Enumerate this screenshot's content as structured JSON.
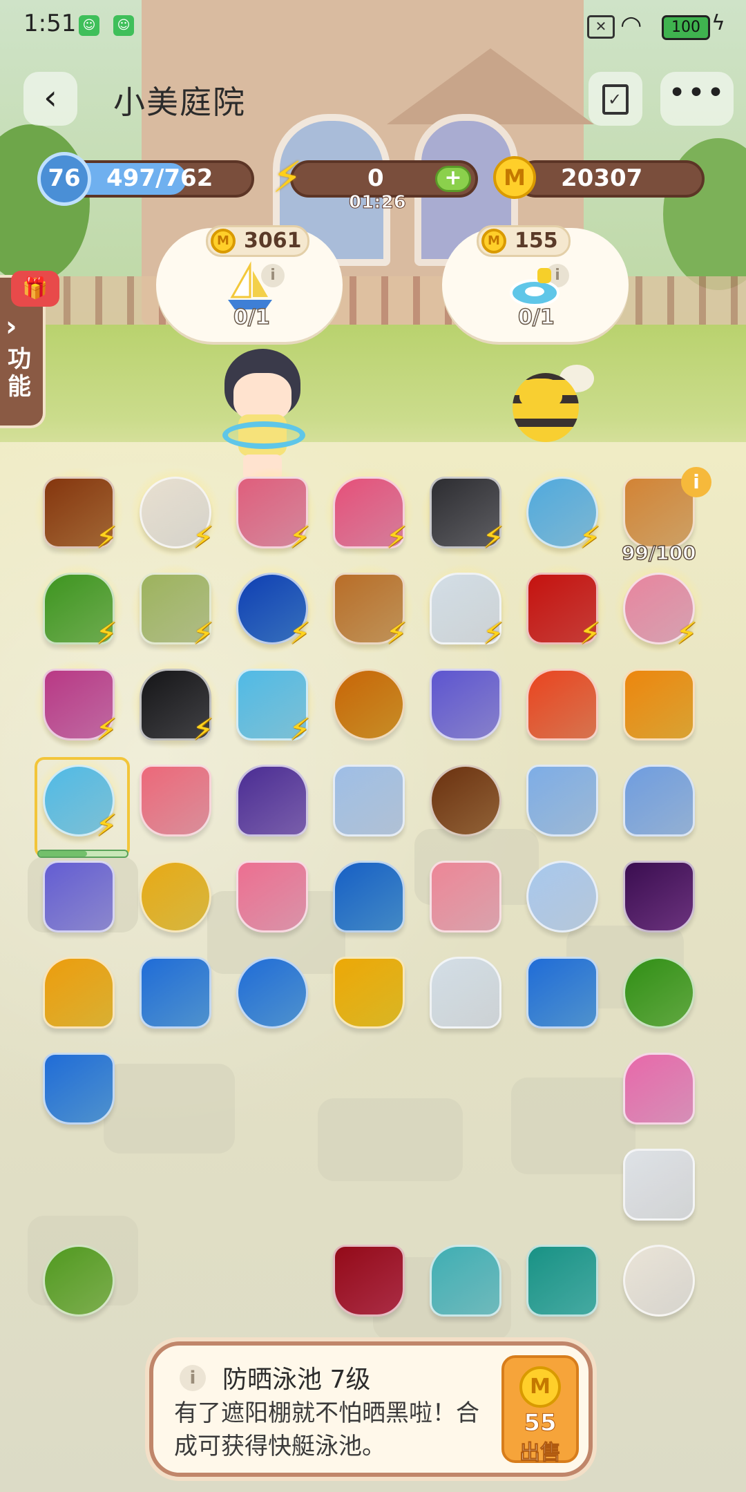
{
  "status_bar": {
    "time": "1:51",
    "battery": "100"
  },
  "header": {
    "title": "小美庭院"
  },
  "resources": {
    "level": "76",
    "xp": "497/762",
    "xp_progress": 0.65,
    "energy": "0",
    "energy_timer": "01:26",
    "coins": "20307"
  },
  "side_tab": {
    "label": "功能"
  },
  "orders": [
    {
      "reward": "3061",
      "progress": "0/1",
      "item_icon": "sailboat-icon"
    },
    {
      "reward": "155",
      "progress": "0/1",
      "item_icon": "swim-ring-icon"
    }
  ],
  "board": {
    "capacity": "99/100",
    "selected_item_progress": 0.55,
    "items": [
      {
        "name": "fruit-stand",
        "row": 0,
        "col": 0,
        "energy": true,
        "color": "#b8753c"
      },
      {
        "name": "chicken-basket",
        "row": 0,
        "col": 1,
        "energy": true,
        "color": "#f3efe6"
      },
      {
        "name": "shopping-cart",
        "row": 0,
        "col": 2,
        "energy": true,
        "color": "#ef9bb2"
      },
      {
        "name": "pink-handbag",
        "row": 0,
        "col": 3,
        "energy": true,
        "color": "#f28fb0"
      },
      {
        "name": "safe-box",
        "row": 0,
        "col": 4,
        "energy": true,
        "color": "#6b6b70"
      },
      {
        "name": "vending-fridge",
        "row": 0,
        "col": 5,
        "energy": true,
        "color": "#8fd0ee"
      },
      {
        "name": "storage-crate",
        "row": 0,
        "col": 6,
        "energy": false,
        "color": "#e8b774"
      },
      {
        "name": "flower-planter",
        "row": 1,
        "col": 0,
        "energy": true,
        "color": "#7dc35a"
      },
      {
        "name": "wicker-chair",
        "row": 1,
        "col": 1,
        "energy": true,
        "color": "#c8d69a"
      },
      {
        "name": "blue-locker",
        "row": 1,
        "col": 2,
        "energy": true,
        "color": "#3e7fd6"
      },
      {
        "name": "wooden-cabinet",
        "row": 1,
        "col": 3,
        "energy": true,
        "color": "#d9a765"
      },
      {
        "name": "greenhouse",
        "row": 1,
        "col": 4,
        "energy": true,
        "color": "#e8eef2"
      },
      {
        "name": "red-treasure-chest",
        "row": 1,
        "col": 5,
        "energy": true,
        "color": "#e0453f"
      },
      {
        "name": "glass-display-case",
        "row": 1,
        "col": 6,
        "energy": true,
        "color": "#f3b8c9"
      },
      {
        "name": "makeup-box",
        "row": 2,
        "col": 0,
        "energy": true,
        "color": "#d978b8"
      },
      {
        "name": "bbq-grill",
        "row": 2,
        "col": 1,
        "energy": true,
        "color": "#4a4a4e"
      },
      {
        "name": "swimming-pool",
        "row": 2,
        "col": 2,
        "energy": true,
        "color": "#8fdaf2"
      },
      {
        "name": "gold-treasure-chest",
        "row": 2,
        "col": 3,
        "energy": false,
        "color": "#e2a12c"
      },
      {
        "name": "purple-chest",
        "row": 2,
        "col": 4,
        "energy": false,
        "color": "#9a93e6"
      },
      {
        "name": "gift-box",
        "row": 2,
        "col": 5,
        "energy": false,
        "color": "#f4845a"
      },
      {
        "name": "energy-orb",
        "row": 2,
        "col": 6,
        "energy": false,
        "color": "#f6b93b"
      },
      {
        "name": "sunshade-pool",
        "row": 3,
        "col": 0,
        "energy": true,
        "color": "#8fdaf2"
      },
      {
        "name": "strawberry-cupcake",
        "row": 3,
        "col": 1,
        "energy": false,
        "color": "#f6a3b0"
      },
      {
        "name": "purple-headband",
        "row": 3,
        "col": 2,
        "energy": false,
        "color": "#8a6bc2"
      },
      {
        "name": "party-hat",
        "row": 3,
        "col": 3,
        "energy": false,
        "color": "#c9dcf2"
      },
      {
        "name": "monkey-plush",
        "row": 3,
        "col": 4,
        "energy": false,
        "color": "#a5703f"
      },
      {
        "name": "sleep-cap",
        "row": 3,
        "col": 5,
        "energy": false,
        "color": "#b3d2f2"
      },
      {
        "name": "blue-cap",
        "row": 3,
        "col": 6,
        "energy": false,
        "color": "#a8c8ef"
      },
      {
        "name": "lavender-chest",
        "row": 4,
        "col": 0,
        "energy": false,
        "color": "#9f9ae8"
      },
      {
        "name": "sailboat",
        "row": 4,
        "col": 1,
        "energy": false,
        "color": "#f3d04a"
      },
      {
        "name": "float-raft",
        "row": 4,
        "col": 2,
        "energy": false,
        "color": "#f6a8c0"
      },
      {
        "name": "dolphin-float",
        "row": 4,
        "col": 3,
        "energy": false,
        "color": "#4c9ce0"
      },
      {
        "name": "pig-doll",
        "row": 4,
        "col": 4,
        "energy": false,
        "color": "#f6b9c4"
      },
      {
        "name": "face-mask",
        "row": 4,
        "col": 5,
        "energy": false,
        "color": "#cfe2f6"
      },
      {
        "name": "grapes",
        "row": 4,
        "col": 6,
        "energy": false,
        "color": "#7a3a8f"
      },
      {
        "name": "paper-boat",
        "row": 5,
        "col": 0,
        "energy": false,
        "color": "#f6c83a"
      },
      {
        "name": "surfboard-1",
        "row": 5,
        "col": 1,
        "energy": false,
        "color": "#5aa6ea"
      },
      {
        "name": "surfboard-2",
        "row": 5,
        "col": 2,
        "energy": false,
        "color": "#5aa6ea"
      },
      {
        "name": "rubber-duck",
        "row": 5,
        "col": 3,
        "energy": false,
        "color": "#f6cf2a"
      },
      {
        "name": "inflatable-boat",
        "row": 5,
        "col": 4,
        "energy": false,
        "color": "#e8eef2"
      },
      {
        "name": "surfboard-3",
        "row": 5,
        "col": 5,
        "energy": false,
        "color": "#5aa6ea"
      },
      {
        "name": "lettuce",
        "row": 5,
        "col": 6,
        "energy": false,
        "color": "#6fbf4a"
      },
      {
        "name": "blue-crystal",
        "row": 6,
        "col": 0,
        "energy": false,
        "color": "#5aa6ea"
      },
      {
        "name": "pink-shell",
        "row": 6,
        "col": 6,
        "energy": false,
        "color": "#f3a3d0"
      },
      {
        "name": "white-egg",
        "row": 7,
        "col": 6,
        "energy": false,
        "color": "#eef0f2"
      },
      {
        "name": "cabbage",
        "row": 8,
        "col": 0,
        "energy": false,
        "color": "#8fc65a"
      },
      {
        "name": "beetroot",
        "row": 8,
        "col": 3,
        "energy": false,
        "color": "#c2334f"
      },
      {
        "name": "water-drop",
        "row": 8,
        "col": 4,
        "energy": false,
        "color": "#7fd3d6"
      },
      {
        "name": "hair-scrunchie",
        "row": 8,
        "col": 5,
        "energy": false,
        "color": "#4fc1b8"
      },
      {
        "name": "cotton-plant",
        "row": 8,
        "col": 6,
        "energy": false,
        "color": "#f4f1ea"
      }
    ]
  },
  "info_panel": {
    "name": "防晒泳池 7级",
    "description": "有了遮阳棚就不怕晒黑啦！合成可获得快艇泳池。",
    "sell_price": "55",
    "sell_label": "出售"
  },
  "colors": {
    "accent": "#7a4e3c",
    "energy": "#ffd41e",
    "coin": "#ffcf2a"
  }
}
